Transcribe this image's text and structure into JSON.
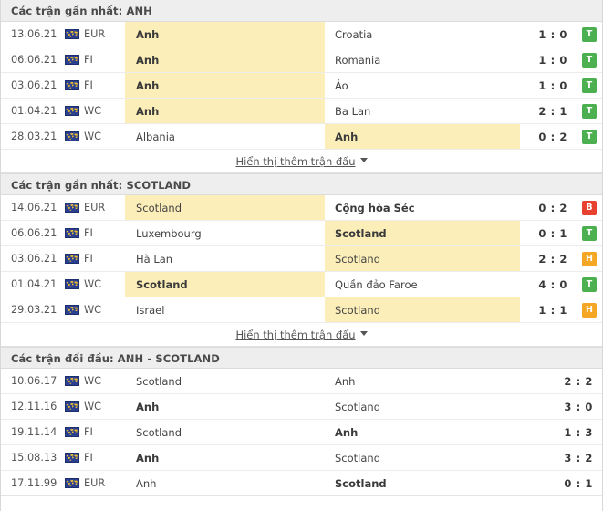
{
  "colors": {
    "win": "#4caf50",
    "loss": "#e8412f",
    "draw": "#f5a623",
    "highlight": "#fbeeb8",
    "header_bg": "#eeeeee"
  },
  "show_more_label": "Hiển thị thêm trận đấu",
  "sections": [
    {
      "title": "Các trận gần nhất: ANH",
      "has_badges": true,
      "has_show_more": true,
      "rows": [
        {
          "date": "13.06.21",
          "flag_icon": "world-map-flag-icon",
          "competition": "EUR",
          "home": "Anh",
          "away": "Croatia",
          "home_bold": true,
          "away_bold": false,
          "home_highlight": true,
          "away_highlight": false,
          "score": "1 : 0",
          "badge": "T",
          "badge_type": "w"
        },
        {
          "date": "06.06.21",
          "flag_icon": "world-map-flag-icon",
          "competition": "FI",
          "home": "Anh",
          "away": "Romania",
          "home_bold": true,
          "away_bold": false,
          "home_highlight": true,
          "away_highlight": false,
          "score": "1 : 0",
          "badge": "T",
          "badge_type": "w"
        },
        {
          "date": "03.06.21",
          "flag_icon": "world-map-flag-icon",
          "competition": "FI",
          "home": "Anh",
          "away": "Áo",
          "home_bold": true,
          "away_bold": false,
          "home_highlight": true,
          "away_highlight": false,
          "score": "1 : 0",
          "badge": "T",
          "badge_type": "w"
        },
        {
          "date": "01.04.21",
          "flag_icon": "world-map-flag-icon",
          "competition": "WC",
          "home": "Anh",
          "away": "Ba Lan",
          "home_bold": true,
          "away_bold": false,
          "home_highlight": true,
          "away_highlight": false,
          "score": "2 : 1",
          "badge": "T",
          "badge_type": "w"
        },
        {
          "date": "28.03.21",
          "flag_icon": "world-map-flag-icon",
          "competition": "WC",
          "home": "Albania",
          "away": "Anh",
          "home_bold": false,
          "away_bold": true,
          "home_highlight": false,
          "away_highlight": true,
          "score": "0 : 2",
          "badge": "T",
          "badge_type": "w"
        }
      ]
    },
    {
      "title": "Các trận gần nhất: SCOTLAND",
      "has_badges": true,
      "has_show_more": true,
      "rows": [
        {
          "date": "14.06.21",
          "flag_icon": "world-map-flag-icon",
          "competition": "EUR",
          "home": "Scotland",
          "away": "Cộng hòa Séc",
          "home_bold": false,
          "away_bold": true,
          "home_highlight": true,
          "away_highlight": false,
          "score": "0 : 2",
          "badge": "B",
          "badge_type": "l"
        },
        {
          "date": "06.06.21",
          "flag_icon": "world-map-flag-icon",
          "competition": "FI",
          "home": "Luxembourg",
          "away": "Scotland",
          "home_bold": false,
          "away_bold": true,
          "home_highlight": false,
          "away_highlight": true,
          "score": "0 : 1",
          "badge": "T",
          "badge_type": "w"
        },
        {
          "date": "03.06.21",
          "flag_icon": "world-map-flag-icon",
          "competition": "FI",
          "home": "Hà Lan",
          "away": "Scotland",
          "home_bold": false,
          "away_bold": false,
          "home_highlight": false,
          "away_highlight": true,
          "score": "2 : 2",
          "badge": "H",
          "badge_type": "d"
        },
        {
          "date": "01.04.21",
          "flag_icon": "world-map-flag-icon",
          "competition": "WC",
          "home": "Scotland",
          "away": "Quần đảo Faroe",
          "home_bold": true,
          "away_bold": false,
          "home_highlight": true,
          "away_highlight": false,
          "score": "4 : 0",
          "badge": "T",
          "badge_type": "w"
        },
        {
          "date": "29.03.21",
          "flag_icon": "world-map-flag-icon",
          "competition": "WC",
          "home": "Israel",
          "away": "Scotland",
          "home_bold": false,
          "away_bold": false,
          "home_highlight": false,
          "away_highlight": true,
          "score": "1 : 1",
          "badge": "H",
          "badge_type": "d"
        }
      ]
    },
    {
      "title": "Các trận đối đầu: ANH - SCOTLAND",
      "has_badges": false,
      "has_show_more": false,
      "rows": [
        {
          "date": "10.06.17",
          "flag_icon": "world-map-flag-icon",
          "competition": "WC",
          "home": "Scotland",
          "away": "Anh",
          "home_bold": false,
          "away_bold": false,
          "home_highlight": false,
          "away_highlight": false,
          "score": "2 : 2",
          "badge": "",
          "badge_type": ""
        },
        {
          "date": "12.11.16",
          "flag_icon": "world-map-flag-icon",
          "competition": "WC",
          "home": "Anh",
          "away": "Scotland",
          "home_bold": true,
          "away_bold": false,
          "home_highlight": false,
          "away_highlight": false,
          "score": "3 : 0",
          "badge": "",
          "badge_type": ""
        },
        {
          "date": "19.11.14",
          "flag_icon": "world-map-flag-icon",
          "competition": "FI",
          "home": "Scotland",
          "away": "Anh",
          "home_bold": false,
          "away_bold": true,
          "home_highlight": false,
          "away_highlight": false,
          "score": "1 : 3",
          "badge": "",
          "badge_type": ""
        },
        {
          "date": "15.08.13",
          "flag_icon": "world-map-flag-icon",
          "competition": "FI",
          "home": "Anh",
          "away": "Scotland",
          "home_bold": true,
          "away_bold": false,
          "home_highlight": false,
          "away_highlight": false,
          "score": "3 : 2",
          "badge": "",
          "badge_type": ""
        },
        {
          "date": "17.11.99",
          "flag_icon": "world-map-flag-icon",
          "competition": "EUR",
          "home": "Anh",
          "away": "Scotland",
          "home_bold": false,
          "away_bold": true,
          "home_highlight": false,
          "away_highlight": false,
          "score": "0 : 1",
          "badge": "",
          "badge_type": ""
        }
      ]
    }
  ]
}
